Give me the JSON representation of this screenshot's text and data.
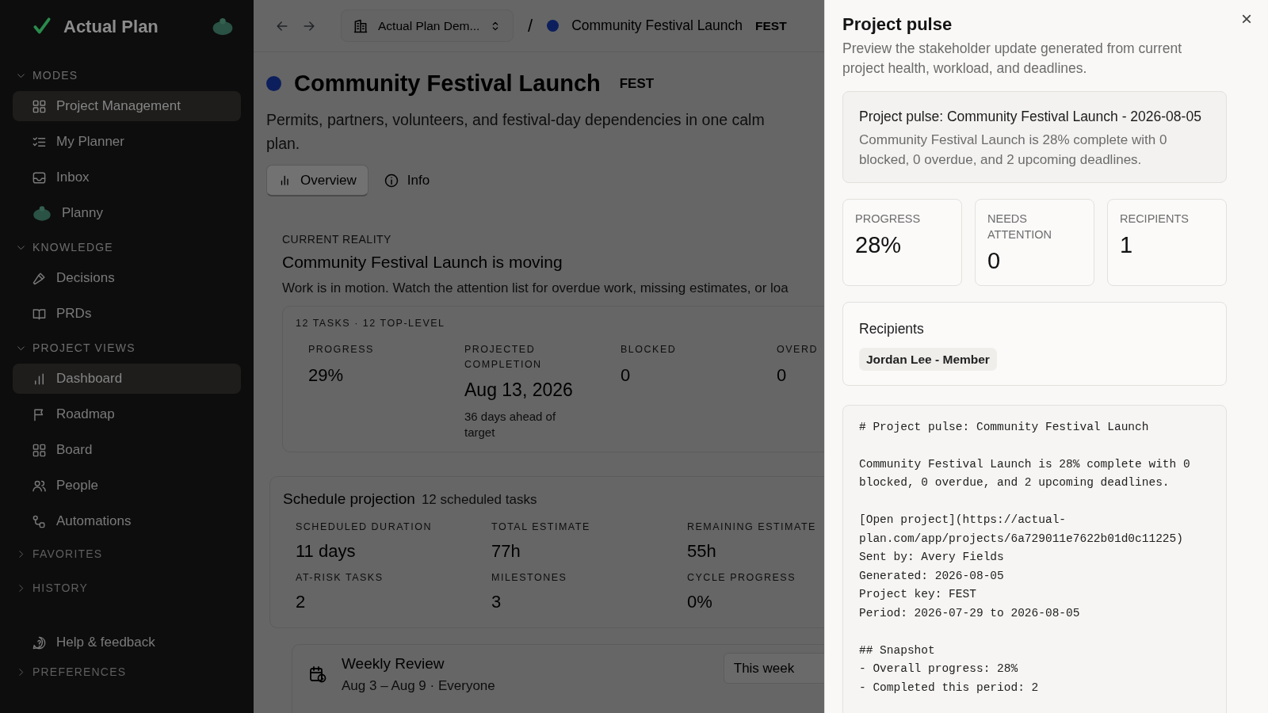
{
  "sidebar": {
    "app_name": "Actual Plan",
    "sections": [
      {
        "title": "MODES",
        "expanded": true,
        "items": [
          {
            "label": "Project Management",
            "selected": true
          },
          {
            "label": "My Planner",
            "selected": false
          },
          {
            "label": "Inbox",
            "selected": false
          },
          {
            "label": "Planny",
            "selected": false
          }
        ]
      },
      {
        "title": "KNOWLEDGE",
        "expanded": true,
        "items": [
          {
            "label": "Decisions",
            "selected": false
          },
          {
            "label": "PRDs",
            "selected": false
          }
        ]
      },
      {
        "title": "PROJECT VIEWS",
        "expanded": true,
        "items": [
          {
            "label": "Dashboard",
            "selected": true
          },
          {
            "label": "Roadmap",
            "selected": false
          },
          {
            "label": "Board",
            "selected": false
          },
          {
            "label": "People",
            "selected": false
          },
          {
            "label": "Automations",
            "selected": false
          }
        ]
      },
      {
        "title": "FAVORITES",
        "expanded": false
      },
      {
        "title": "HISTORY",
        "expanded": false
      }
    ],
    "footer_item": {
      "label": "Help & feedback"
    },
    "footer_section": {
      "title": "PREFERENCES",
      "expanded": false
    }
  },
  "topbar": {
    "workspace": "Actual Plan Dem...",
    "separator": "/",
    "project": "Community Festival Launch",
    "project_key": "FEST"
  },
  "project": {
    "title": "Community Festival Launch",
    "key": "FEST",
    "description": "Permits, partners, volunteers, and festival-day dependencies in one calm plan.",
    "tabs": [
      {
        "label": "Overview",
        "selected": true
      },
      {
        "label": "Info",
        "selected": false
      }
    ]
  },
  "current_reality": {
    "label": "CURRENT REALITY",
    "heading": "Community Festival Launch is moving",
    "text": "Work is in motion. Watch the attention list for overdue work, missing estimates, or loa",
    "summary": "12 TASKS · 12 TOP-LEVEL",
    "stats": [
      {
        "label": "PROGRESS",
        "value": "29%"
      },
      {
        "label": "PROJECTED COMPLETION",
        "value": "Aug 13, 2026",
        "note": "36 days ahead of target"
      },
      {
        "label": "BLOCKED",
        "value": "0"
      },
      {
        "label": "OVERD",
        "value": "0"
      }
    ]
  },
  "schedule": {
    "title": "Schedule projection",
    "subtitle": "12 scheduled tasks",
    "stats": [
      {
        "label": "SCHEDULED DURATION",
        "value": "11 days"
      },
      {
        "label": "TOTAL ESTIMATE",
        "value": "77h"
      },
      {
        "label": "REMAINING ESTIMATE",
        "value": "55h"
      },
      {
        "label": "AT-RISK TASKS",
        "value": "2"
      },
      {
        "label": "MILESTONES",
        "value": "3"
      },
      {
        "label": "CYCLE PROGRESS",
        "value": "0%"
      }
    ]
  },
  "review": {
    "title": "Weekly Review",
    "subtitle": "Aug 3 – Aug 9 · Everyone",
    "range": "This week"
  },
  "drawer": {
    "title": "Project pulse",
    "close": "×",
    "description": "Preview the stakeholder update generated from current project health, workload, and deadlines.",
    "summary_title": "Project pulse: Community Festival Launch - 2026-08-05",
    "summary_text": "Community Festival Launch is 28% complete with 0 blocked, 0 overdue, and 2 upcoming deadlines.",
    "metrics": [
      {
        "label": "PROGRESS",
        "value": "28%"
      },
      {
        "label": "NEEDS ATTENTION",
        "value": "0"
      },
      {
        "label": "RECIPIENTS",
        "value": "1"
      }
    ],
    "recipients_title": "Recipients",
    "recipients": [
      "Jordan Lee - Member"
    ],
    "markdown": [
      [
        "# Project pulse: Community Festival Launch"
      ],
      [
        "Community Festival Launch is 28% complete with 0 blocked, 0 overdue, and 2 upcoming deadlines."
      ],
      [
        "[Open project](https://actual-plan.com/app/projects/6a729011e7622b01d0c11225)",
        "Sent by: Avery Fields",
        "Generated: 2026-08-05",
        "Project key: FEST",
        "Period: 2026-07-29 to 2026-08-05"
      ],
      [
        "## Snapshot",
        "- Overall progress: 28%",
        "- Completed this period: 2"
      ]
    ]
  }
}
